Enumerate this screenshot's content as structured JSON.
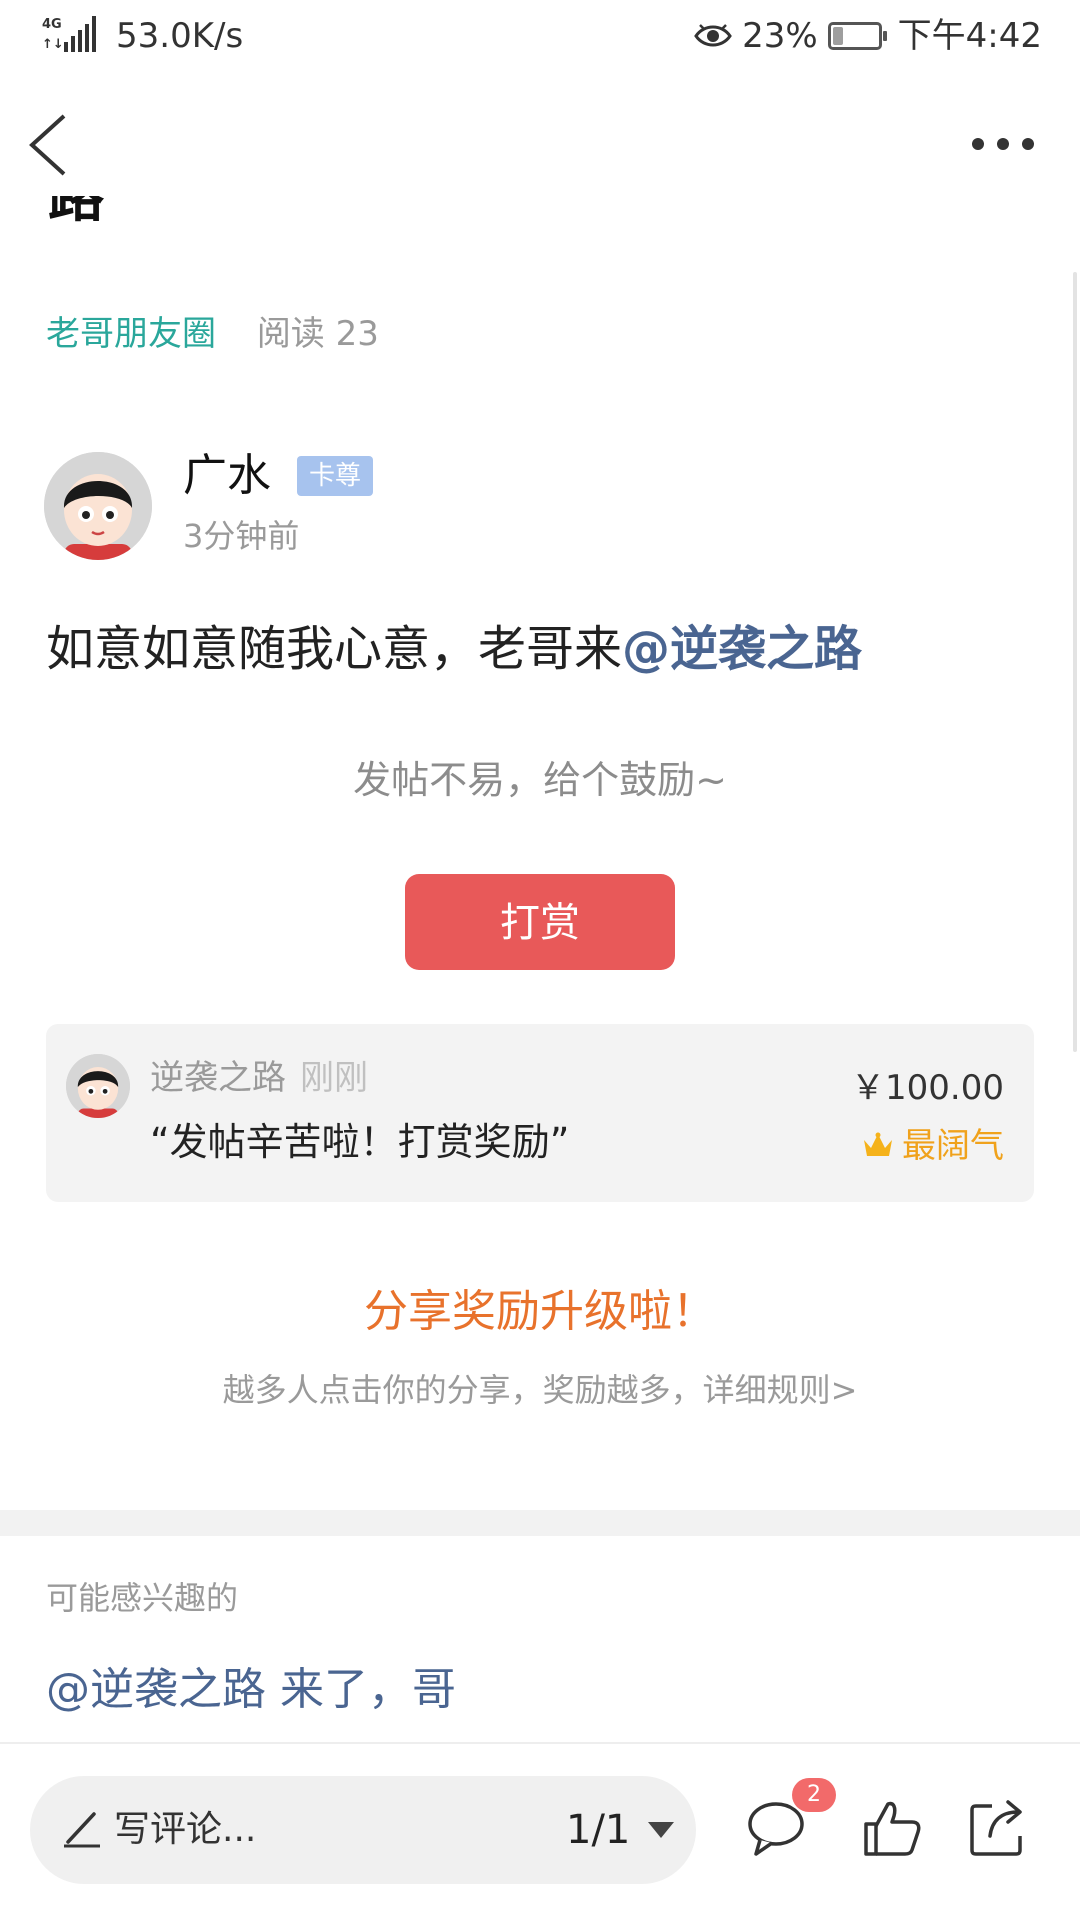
{
  "status_bar": {
    "network": "4G",
    "speed": "53.0K/s",
    "battery_percent": "23%",
    "battery_level": 0.23,
    "time": "下午4:42"
  },
  "header": {
    "partial_title": "路"
  },
  "post": {
    "circle": "老哥朋友圈",
    "reads": "阅读 23",
    "author": "广水",
    "badge": "卡尊",
    "time": "3分钟前",
    "content_text": "如意如意随我心意，老哥来",
    "content_mention": "@逆袭之路"
  },
  "reward": {
    "prompt": "发帖不易，给个鼓励~",
    "button_label": "打赏"
  },
  "tip": {
    "user": "逆袭之路",
    "time": "刚刚",
    "message": "“发帖辛苦啦！打赏奖励”",
    "amount": "￥100.00",
    "rank": "最阔气"
  },
  "share": {
    "title": "分享奖励升级啦！",
    "subtitle": "越多人点击你的分享，奖励越多，详细规则>"
  },
  "related": {
    "title": "可能感兴趣的",
    "items": [
      "@逆袭之路 来了，哥"
    ]
  },
  "bottom_bar": {
    "comment_placeholder": "写评论...",
    "page": "1/1",
    "comment_count": "2"
  },
  "colors": {
    "accent_green": "#2aa79b",
    "mention_blue": "#4a6591",
    "reward_red": "#e85959",
    "share_orange": "#e8722c",
    "rank_gold": "#f0a21c"
  }
}
